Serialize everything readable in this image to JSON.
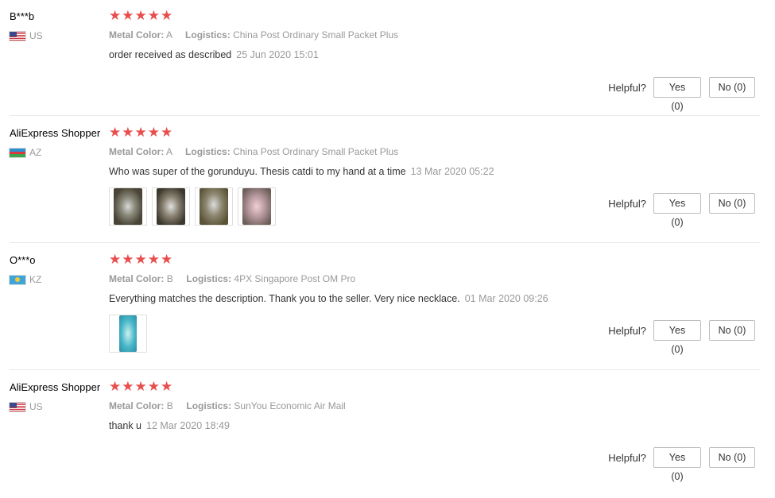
{
  "common": {
    "star_glyph": "★",
    "helpful_label": "Helpful?",
    "metal_color_label": "Metal Color:",
    "logistics_label": "Logistics:"
  },
  "colors": {
    "star": "#e84e4e",
    "divider": "#e8e8e8",
    "muted_text": "#999999",
    "body_text": "#333333"
  },
  "reviews": [
    {
      "user": "B***b",
      "country": "US",
      "flag": "us-flag-icon",
      "rating": 5,
      "metal_color": "A",
      "logistics": "China Post Ordinary Small Packet Plus",
      "text": "order received as described",
      "date": "25 Jun 2020 15:01",
      "yes": "Yes (0)",
      "no": "No (0)",
      "photos": []
    },
    {
      "user": "AliExpress Shopper",
      "country": "AZ",
      "flag": "az-flag-icon",
      "rating": 5,
      "metal_color": "A",
      "logistics": "China Post Ordinary Small Packet Plus",
      "text": "Who was super of the gorunduyu. Thesis catdi to my hand at a time",
      "date": "13 Mar 2020 05:22",
      "yes": "Yes (0)",
      "no": "No (0)",
      "photos": [
        "review-photo",
        "review-photo",
        "review-photo",
        "review-photo"
      ]
    },
    {
      "user": "O***o",
      "country": "KZ",
      "flag": "kz-flag-icon",
      "rating": 5,
      "metal_color": "B",
      "logistics": "4PX Singapore Post OM Pro",
      "text": "Everything matches the description. Thank you to the seller. Very nice necklace.",
      "date": "01 Mar 2020 09:26",
      "yes": "Yes (0)",
      "no": "No (0)",
      "photos": [
        "review-photo"
      ]
    },
    {
      "user": "AliExpress Shopper",
      "country": "US",
      "flag": "us-flag-icon",
      "rating": 5,
      "metal_color": "B",
      "logistics": "SunYou Economic Air Mail",
      "text": "thank u",
      "date": "12 Mar 2020 18:49",
      "yes": "Yes (0)",
      "no": "No (0)",
      "photos": []
    }
  ]
}
